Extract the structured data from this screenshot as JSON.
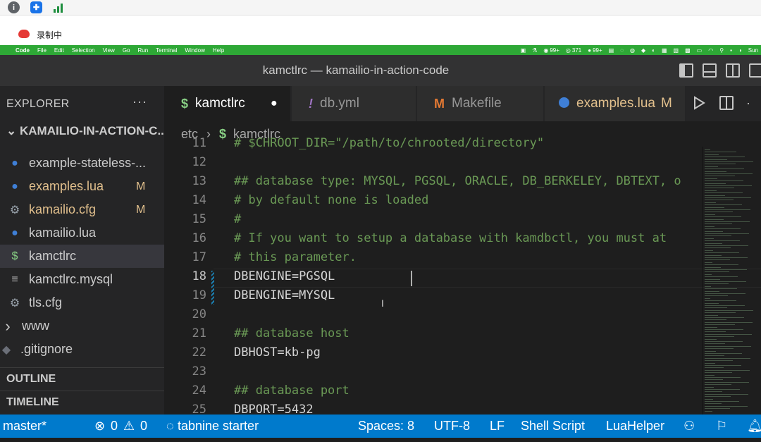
{
  "recording": {
    "label": "录制中"
  },
  "menubar": {
    "app": "Code",
    "items": [
      "File",
      "Edit",
      "Selection",
      "View",
      "Go",
      "Run",
      "Terminal",
      "Window",
      "Help"
    ],
    "status": [
      "99+",
      "371",
      "99+",
      "Sun"
    ]
  },
  "window": {
    "title": "kamctlrc — kamailio-in-action-code"
  },
  "sidebar": {
    "explorer_label": "EXPLORER",
    "more_label": "···",
    "folder": "KAMAILIO-IN-ACTION-C...",
    "items": [
      {
        "label": "example-stateless-...",
        "icon": "lua-icon",
        "badge": "",
        "color": "#cccccc"
      },
      {
        "label": "examples.lua",
        "icon": "lua-icon",
        "badge": "M",
        "color": "#e2c08d"
      },
      {
        "label": "kamailio.cfg",
        "icon": "gear-icon",
        "badge": "M",
        "color": "#e2c08d"
      },
      {
        "label": "kamailio.lua",
        "icon": "lua-icon",
        "badge": "",
        "color": "#cccccc"
      },
      {
        "label": "kamctlrc",
        "icon": "dollar-icon",
        "badge": "",
        "color": "#cccccc"
      },
      {
        "label": "kamctlrc.mysql",
        "icon": "lines-icon",
        "badge": "",
        "color": "#cccccc"
      },
      {
        "label": "tls.cfg",
        "icon": "gear-icon",
        "badge": "",
        "color": "#cccccc"
      },
      {
        "label": "www",
        "icon": "chevron-right-icon",
        "badge": "",
        "color": "#cccccc"
      },
      {
        "label": ".gitignore",
        "icon": "git-icon",
        "badge": "",
        "color": "#cccccc"
      }
    ],
    "outline": "OUTLINE",
    "timeline": "TIMELINE"
  },
  "tabs": [
    {
      "label": "kamctlrc",
      "icon": "$",
      "dirty": "●",
      "active": true
    },
    {
      "label": "db.yml",
      "icon": "!",
      "active": false
    },
    {
      "label": "Makefile",
      "icon": "M",
      "active": false
    },
    {
      "label": "examples.lua",
      "icon": "lua",
      "badge": "M",
      "active": false
    }
  ],
  "breadcrumb": {
    "folder": "etc",
    "sep": "›",
    "file": "kamctlrc"
  },
  "editor": {
    "lines": [
      {
        "n": "11",
        "text": "# $CHROOT_DIR=\"/path/to/chrooted/directory\"",
        "kind": "cmt"
      },
      {
        "n": "12",
        "text": "",
        "kind": "code"
      },
      {
        "n": "13",
        "text": "## database type: MYSQL, PGSQL, ORACLE, DB_BERKELEY, DBTEXT, o",
        "kind": "cmt"
      },
      {
        "n": "14",
        "text": "# by default none is loaded",
        "kind": "cmt"
      },
      {
        "n": "15",
        "text": "#",
        "kind": "cmt"
      },
      {
        "n": "16",
        "text": "# If you want to setup a database with kamdbctl, you must at",
        "kind": "cmt"
      },
      {
        "n": "17",
        "text": "# this parameter.",
        "kind": "cmt"
      },
      {
        "n": "18",
        "text": "DBENGINE=PGSQL",
        "kind": "code"
      },
      {
        "n": "19",
        "text": "DBENGINE=MYSQL",
        "kind": "code"
      },
      {
        "n": "20",
        "text": "",
        "kind": "code"
      },
      {
        "n": "21",
        "text": "## database host",
        "kind": "cmt"
      },
      {
        "n": "22",
        "text": "DBHOST=kb-pg",
        "kind": "code"
      },
      {
        "n": "23",
        "text": "",
        "kind": "code"
      },
      {
        "n": "24",
        "text": "## database port",
        "kind": "cmt"
      },
      {
        "n": "25",
        "text": "DBPORT=5432",
        "kind": "code"
      }
    ],
    "current_line": "18"
  },
  "status": {
    "branch": "master*",
    "errors": "0",
    "warnings": "0",
    "tabnine": "tabnine starter",
    "spaces": "Spaces: 8",
    "encoding": "UTF-8",
    "eol": "LF",
    "language": "Shell Script",
    "helper": "LuaHelper"
  },
  "colors": {
    "statusbar": "#007acc",
    "menubar": "#2ea836",
    "modified": "#e2c08d",
    "comment": "#6a9955"
  }
}
